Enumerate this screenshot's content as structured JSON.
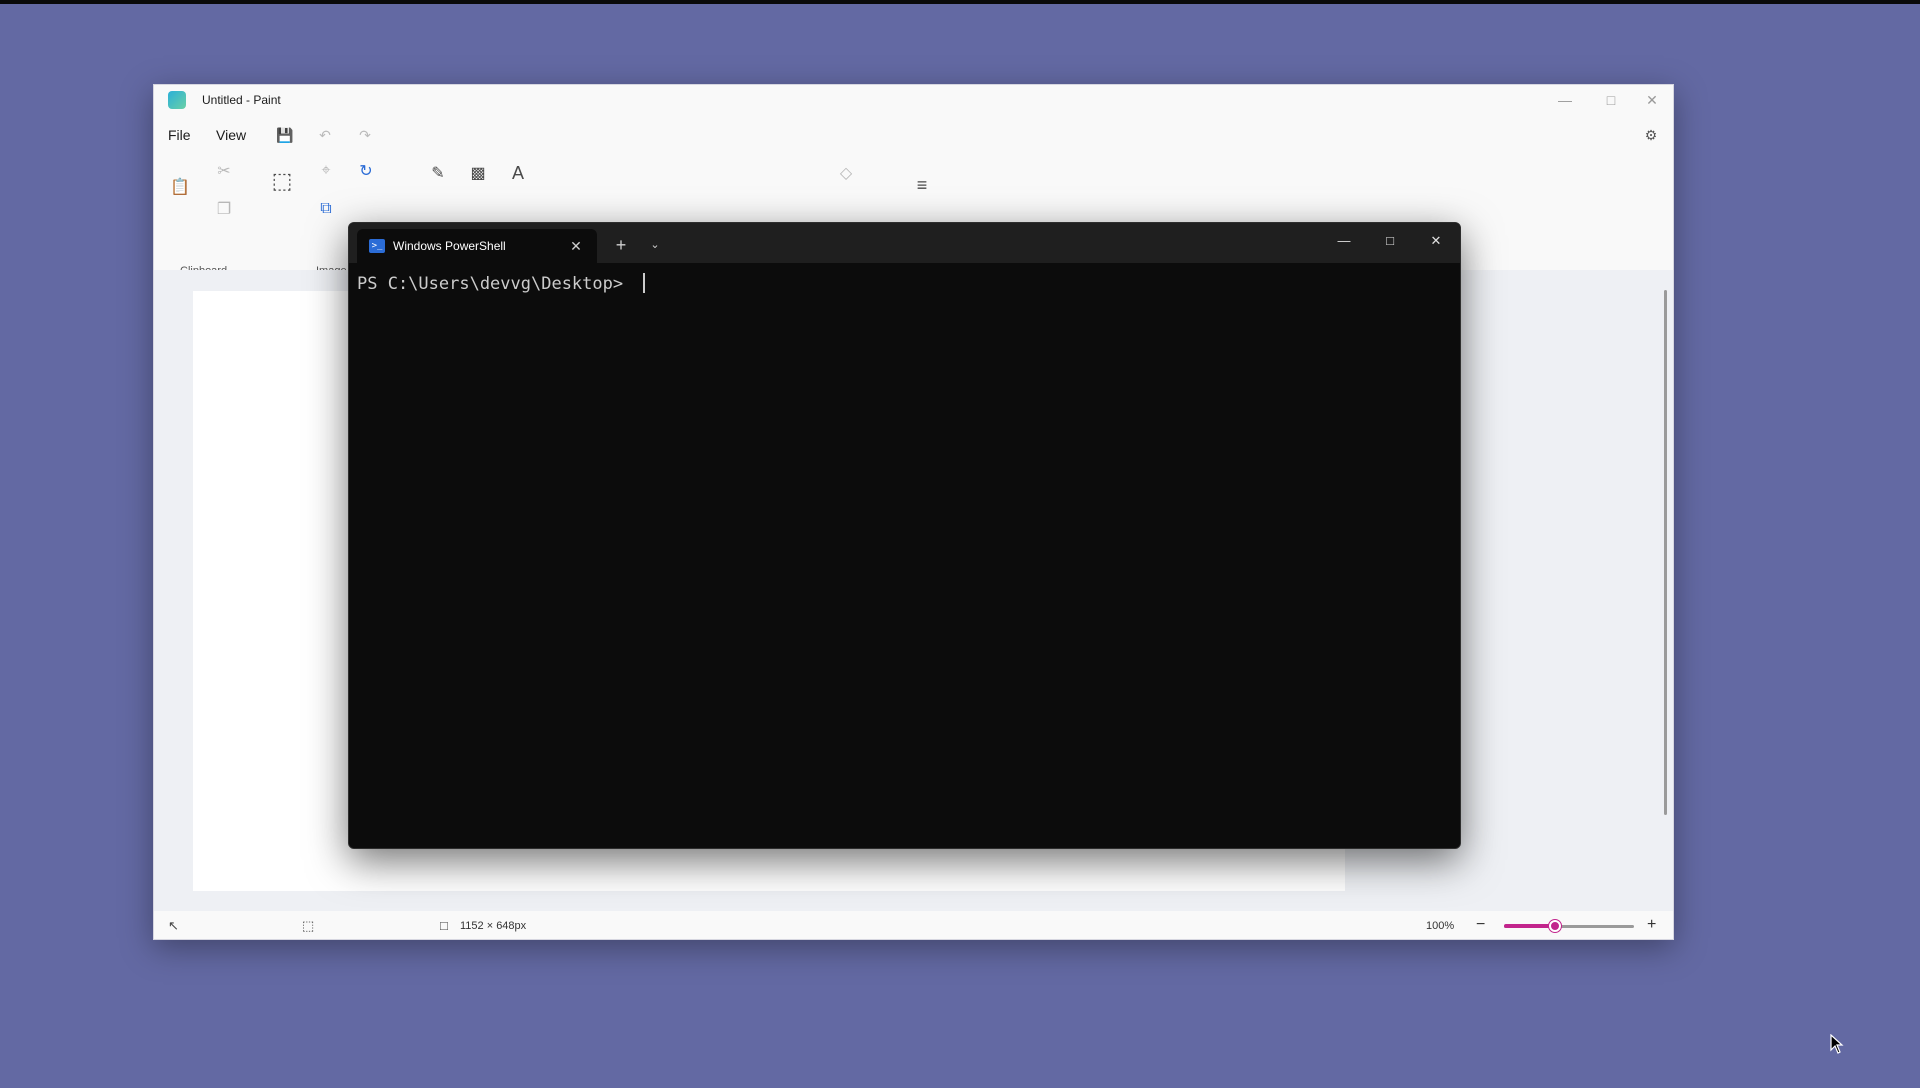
{
  "paint": {
    "title": "Untitled - Paint",
    "menu": {
      "file": "File",
      "view": "View"
    },
    "groups": {
      "clipboard": "Clipboard",
      "image": "Image"
    },
    "shapes": [
      "╲",
      "∿",
      "○",
      "□",
      "▢",
      "⬠",
      "△",
      "◺",
      "◇",
      "⬠",
      "⬡",
      "⇨",
      "⇦",
      "⇧",
      "⇩",
      "✦"
    ],
    "palette": [
      "#000000",
      "#7f7f7f",
      "#880015",
      "#ed1c24",
      "#ff7f27",
      "#fff200",
      "#22b14c",
      "#00a2e8",
      "#3f48cc",
      "#a349a4",
      "#ffffff",
      "#c3c3c3",
      "#b97a57",
      "#ffaec9",
      "#ffc90e",
      "#efe4b0",
      "#b5e61d",
      "#99d9ea",
      "#7092be",
      "#c8bfe7"
    ],
    "current_color": "#000000",
    "status": {
      "canvas_size": "1152 × 648px",
      "zoom": "100%"
    },
    "zoom_level_percent": 100
  },
  "terminal": {
    "tab_title": "Windows PowerShell",
    "prompt": "PS C:\\Users\\devvg\\Desktop> "
  },
  "colors": {
    "desktop": "#6369a3",
    "terminal_bg": "#0c0c0c",
    "accent": "#c2248c"
  }
}
